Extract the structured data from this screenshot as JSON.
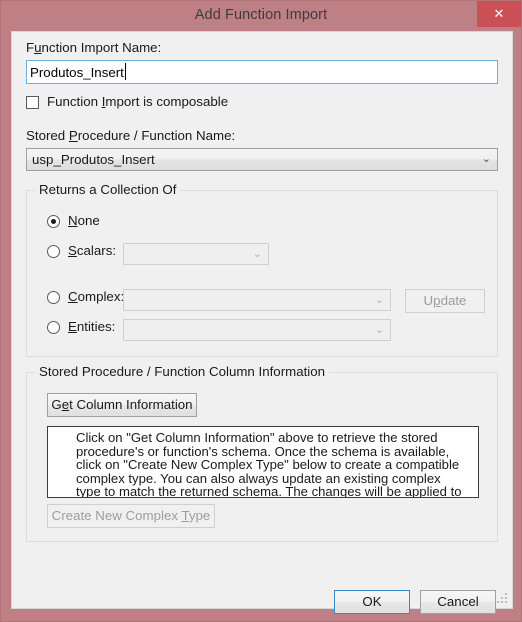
{
  "window": {
    "title": "Add Function Import",
    "close_icon": "close-icon",
    "close_glyph": "✕",
    "frame_color": "#bf8085",
    "close_button_color": "#cb5055",
    "client_background": "#f0f0f0"
  },
  "form": {
    "function_import_name": {
      "label_pre": "F",
      "label_accel": "u",
      "label_post": "nction Import Name:",
      "label_full": "Function Import Name:",
      "value": "Produtos_Insert",
      "focused": true
    },
    "composable": {
      "label_pre": "Function ",
      "label_accel": "I",
      "label_post": "mport is composable",
      "label_full": "Function Import is composable",
      "checked": false
    },
    "stored_procedure": {
      "label_pre": "Stored ",
      "label_accel": "P",
      "label_post": "rocedure / Function Name:",
      "label_full": "Stored Procedure / Function Name:",
      "selected": "usp_Produtos_Insert",
      "arrow_icon": "chevron-down-icon",
      "arrow_glyph": "⌄"
    }
  },
  "returns_group": {
    "title": "Returns a Collection Of",
    "options": [
      {
        "label_pre": "",
        "label_accel": "N",
        "label_post": "one",
        "label_full": "None",
        "checked": true,
        "has_combo": false
      },
      {
        "label_pre": "",
        "label_accel": "S",
        "label_post": "calars:",
        "label_full": "Scalars:",
        "checked": false,
        "has_combo": true,
        "combo_value": ""
      },
      {
        "label_pre": "",
        "label_accel": "C",
        "label_post": "omplex:",
        "label_full": "Complex:",
        "checked": false,
        "has_combo": true,
        "combo_value": ""
      },
      {
        "label_pre": "",
        "label_accel": "E",
        "label_post": "ntities:",
        "label_full": "Entities:",
        "checked": false,
        "has_combo": true,
        "combo_value": ""
      }
    ],
    "update_button": {
      "label_pre": "U",
      "label_accel": "p",
      "label_post": "date",
      "label_full": "Update",
      "enabled": false
    }
  },
  "column_info_group": {
    "title": "Stored Procedure / Function Column Information",
    "get_columns_button": {
      "label_pre": "G",
      "label_accel": "e",
      "label_post": "t Column Information",
      "label_full": "Get Column Information",
      "enabled": true
    },
    "info_text": "Click on \"Get Column Information\" above to retrieve the stored procedure's or function's schema. Once the schema is available, click on \"Create New Complex Type\" below to create a compatible complex type. You can also always update an existing complex type to match the returned schema. The changes will be applied to the model once you ...",
    "create_type_button": {
      "label_pre": "Create New Complex ",
      "label_accel": "T",
      "label_post": "ype",
      "label_full": "Create New Complex Type",
      "enabled": false
    }
  },
  "dialog_buttons": {
    "ok": "OK",
    "cancel": "Cancel",
    "default_button": "OK"
  }
}
